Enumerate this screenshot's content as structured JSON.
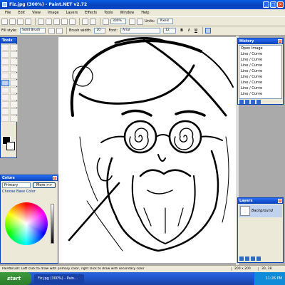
{
  "window": {
    "title": "Fiz.jpg (300%) - Paint.NET v2.72",
    "buttons": [
      "_",
      "□",
      "×"
    ]
  },
  "menu": [
    "File",
    "Edit",
    "View",
    "Image",
    "Layers",
    "Effects",
    "Tools",
    "Window",
    "Help"
  ],
  "toolbar1": {
    "zoom": "300%",
    "units_label": "Units:",
    "units_value": "Pixels"
  },
  "toolbar2": {
    "tool_label": "Fill style:",
    "fill_value": "Solid Brush",
    "brush_width_label": "Brush width:",
    "brush_width_value": "20",
    "font_label": "Font:",
    "font_value": "Arial",
    "font_size": "12",
    "bold": "B",
    "italic": "I",
    "underline": "U"
  },
  "tools_panel": {
    "title": "Tools"
  },
  "history_panel": {
    "title": "History",
    "items": [
      "Open Image",
      "Line / Curve",
      "Line / Curve",
      "Line / Curve",
      "Line / Curve",
      "Line / Curve",
      "Line / Curve",
      "Line / Curve",
      "Line / Curve"
    ]
  },
  "colors_panel": {
    "title": "Colors",
    "mode": "Primary",
    "more_button": "More >>",
    "base_label": "Choose Base Color"
  },
  "layers_panel": {
    "title": "Layers",
    "layer_name": "Background"
  },
  "status": {
    "text": "Paintbrush: Left click to draw with primary color, right click to draw with secondary color",
    "size": "200 x 200",
    "coords": "30, 38"
  },
  "taskbar": {
    "start": "start",
    "tasks": [
      "Fiz.jpg (300%) - Pain..."
    ],
    "clock": "11:26 PM"
  }
}
